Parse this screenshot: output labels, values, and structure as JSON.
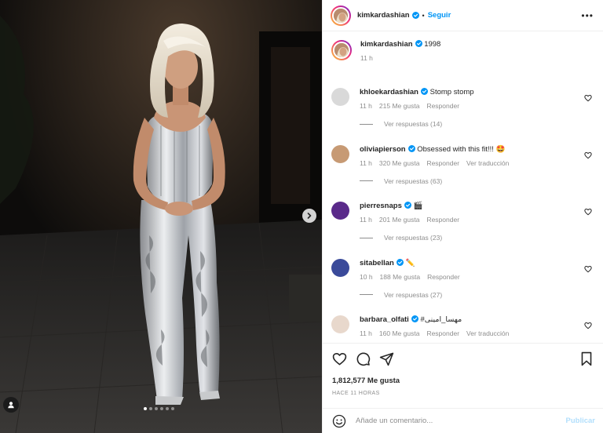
{
  "post": {
    "author": "kimkardashian",
    "follow_label": "Seguir",
    "separator": "•",
    "more_label": "•••",
    "media": {
      "carousel_total": 6,
      "carousel_active": 1
    },
    "caption": {
      "username": "kimkardashian",
      "text": "1998",
      "time": "11 h"
    },
    "comments": [
      {
        "username": "khloekardashian",
        "text": "Stomp stomp",
        "time": "11 h",
        "likes": "215 Me gusta",
        "reply": "Responder",
        "translate": "",
        "replies": "Ver respuestas (14)",
        "avatar_color": "#d9d9d9"
      },
      {
        "username": "oliviapierson",
        "text": "Obsessed with this fit!!! 🤩",
        "time": "11 h",
        "likes": "320 Me gusta",
        "reply": "Responder",
        "translate": "Ver traducción",
        "replies": "Ver respuestas (63)",
        "avatar_color": "#c79a74"
      },
      {
        "username": "pierresnaps",
        "text": "🎬",
        "time": "11 h",
        "likes": "201 Me gusta",
        "reply": "Responder",
        "translate": "",
        "replies": "Ver respuestas (23)",
        "avatar_color": "#5a2a8a"
      },
      {
        "username": "sitabellan",
        "text": "✏️",
        "time": "10 h",
        "likes": "188 Me gusta",
        "reply": "Responder",
        "translate": "",
        "replies": "Ver respuestas (27)",
        "avatar_color": "#3a4a9a"
      },
      {
        "username": "barbara_olfati",
        "text": "#مهسا_امینی",
        "time": "11 h",
        "likes": "160 Me gusta",
        "reply": "Responder",
        "translate": "Ver traducción",
        "replies": "",
        "avatar_color": "#e8d8cc"
      }
    ],
    "likes_total": "1,812,577 Me gusta",
    "posted_ago": "HACE 11 HORAS",
    "composer": {
      "placeholder": "Añade un comentario...",
      "publish_label": "Publicar"
    },
    "colors": {
      "link": "#0095f6",
      "publish_disabled": "#b2dffc",
      "muted": "#8e8e8e",
      "text": "#262626"
    }
  }
}
